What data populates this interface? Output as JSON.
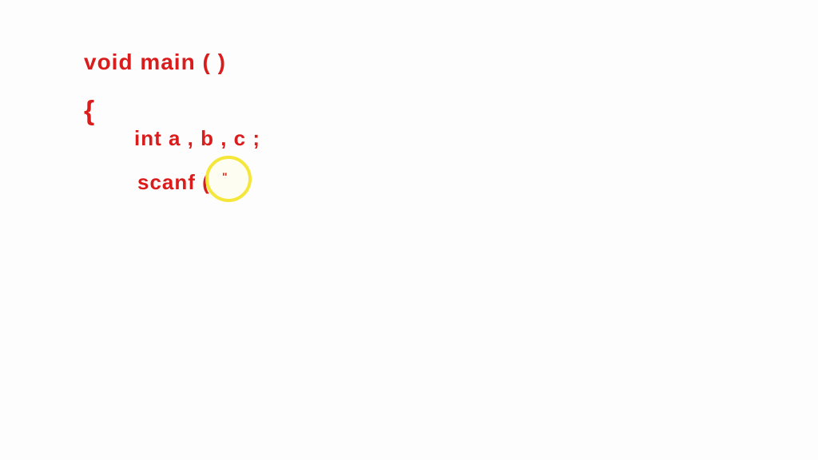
{
  "code": {
    "line1": "void main ( )",
    "line2": "{",
    "line3": "int a , b , c ;",
    "line4": "scanf  (",
    "small_mark": "\""
  },
  "colors": {
    "ink": "#d91c1c",
    "highlight": "#f5e63a"
  }
}
